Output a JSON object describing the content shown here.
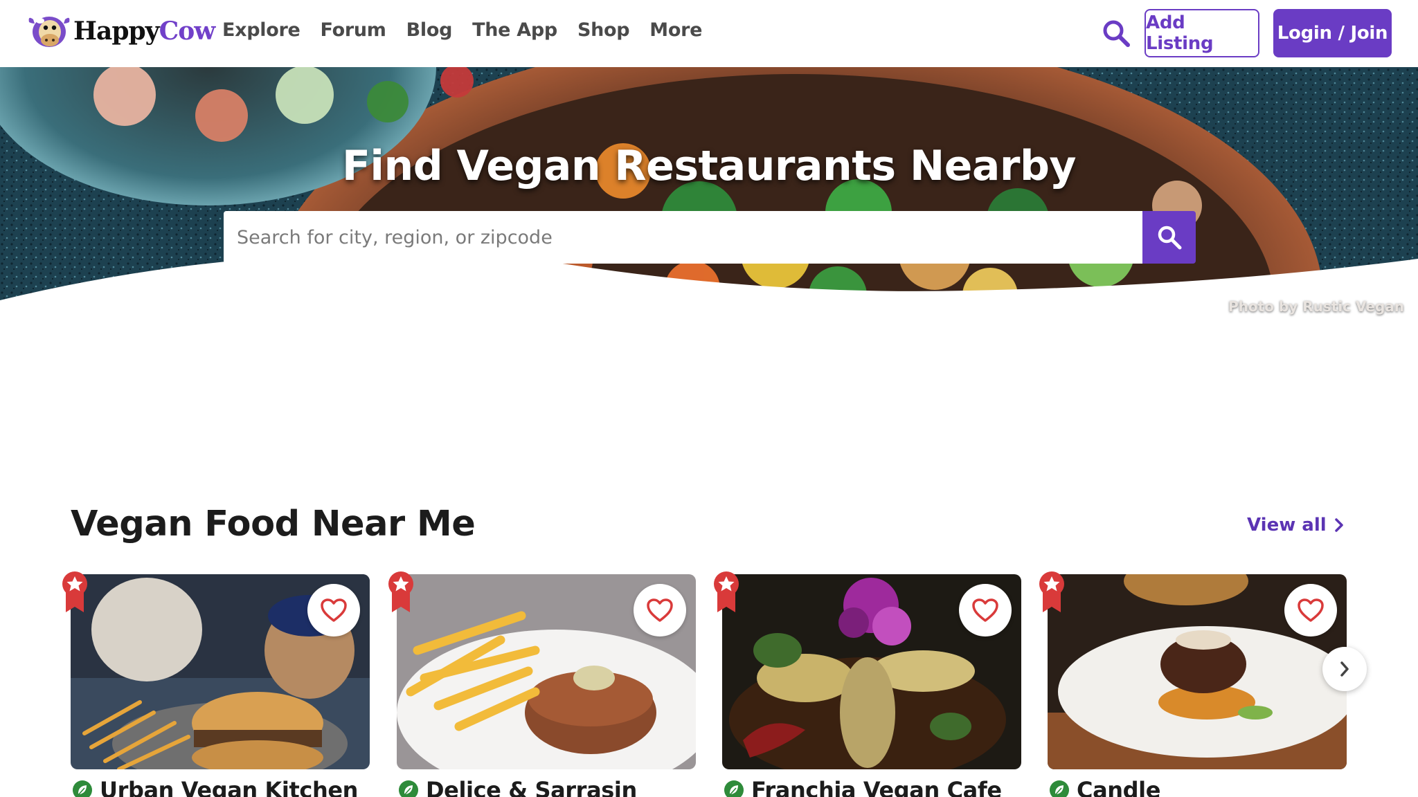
{
  "brand": {
    "happy": "Happy",
    "cow": "Cow"
  },
  "nav": [
    {
      "label": "Explore"
    },
    {
      "label": "Forum"
    },
    {
      "label": "Blog"
    },
    {
      "label": "The App"
    },
    {
      "label": "Shop"
    },
    {
      "label": "More"
    }
  ],
  "header": {
    "add_listing": "Add Listing",
    "login": "Login / Join"
  },
  "hero": {
    "title": "Find Vegan Restaurants Nearby",
    "search_placeholder": "Search for city, region, or zipcode",
    "photo_credit": "Photo by Rustic Vegan"
  },
  "section": {
    "title": "Vegan Food Near Me",
    "view_all": "View all"
  },
  "cards": [
    {
      "name": "Urban Vegan Kitchen"
    },
    {
      "name": "Delice & Sarrasin"
    },
    {
      "name": "Franchia Vegan Cafe"
    },
    {
      "name": "Candle"
    }
  ],
  "colors": {
    "brand_purple": "#6a3cc4",
    "heart_red": "#d93a3a",
    "leaf_green": "#2e8b3a"
  }
}
